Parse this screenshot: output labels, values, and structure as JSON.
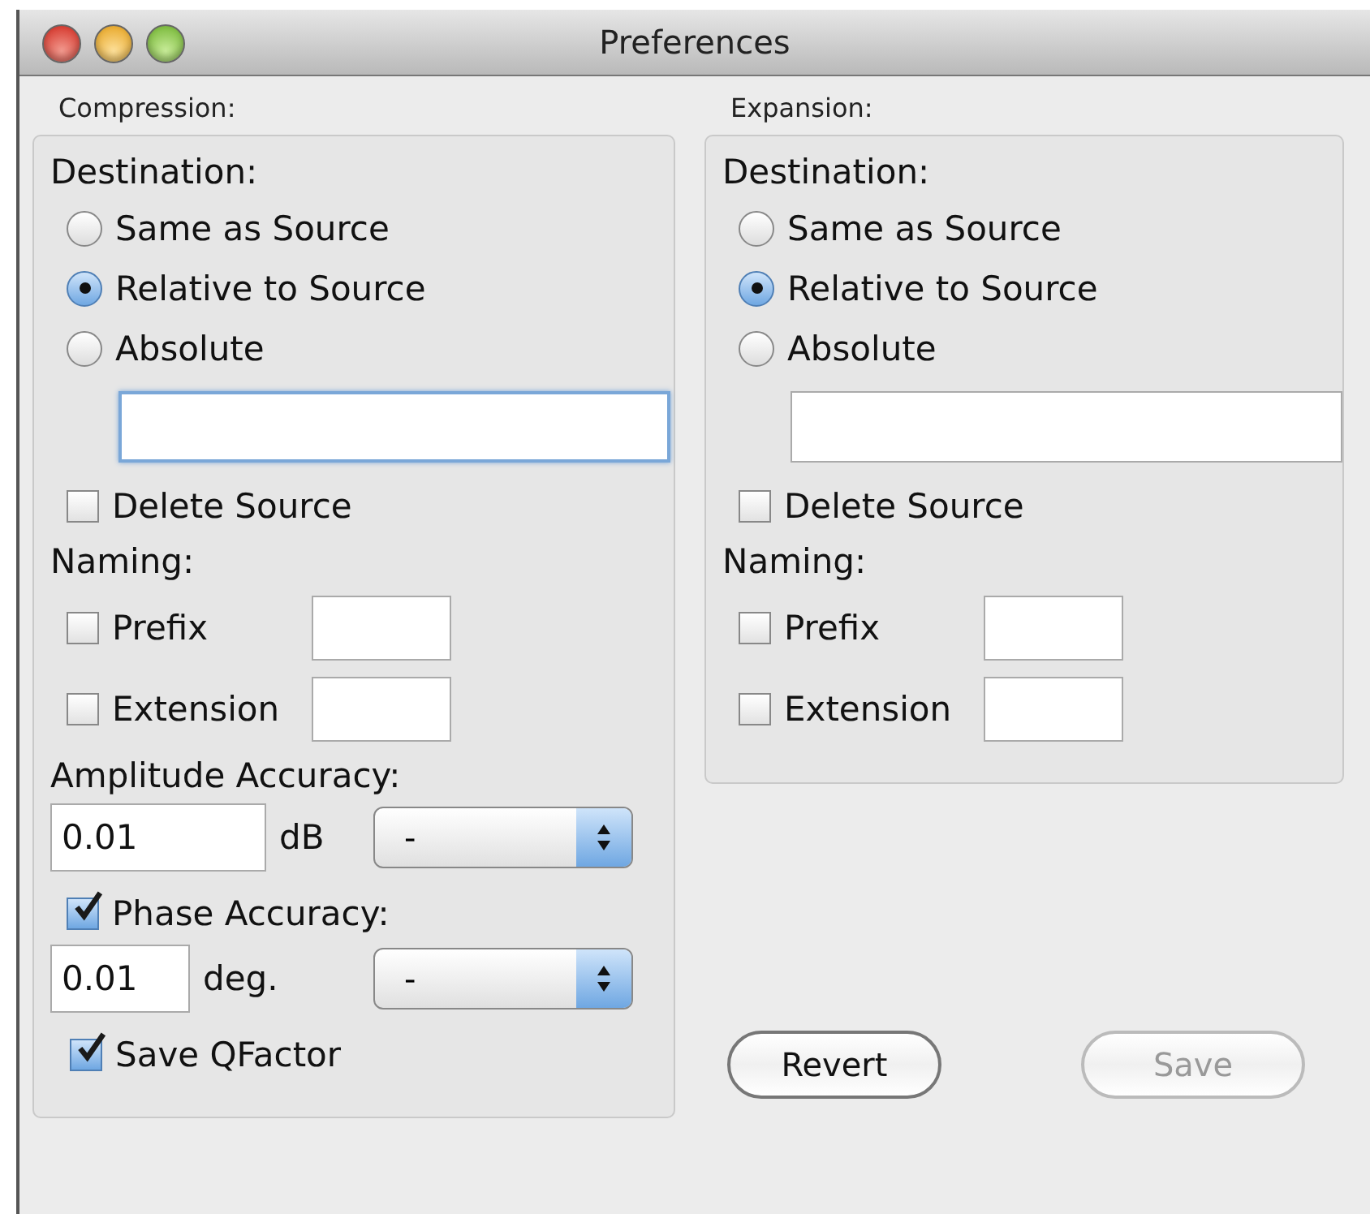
{
  "window": {
    "title": "Preferences"
  },
  "compression": {
    "heading": "Compression:",
    "destination_label": "Destination:",
    "destination_options": [
      {
        "label": "Same as Source",
        "selected": false
      },
      {
        "label": "Relative to Source",
        "selected": true
      },
      {
        "label": "Absolute",
        "selected": false
      }
    ],
    "path_field": {
      "focused": true
    },
    "delete_source": {
      "label": "Delete Source",
      "checked": false
    },
    "naming_label": "Naming:",
    "naming": [
      {
        "label": "Prefix",
        "checked": false
      },
      {
        "label": "Extension",
        "checked": false
      }
    ],
    "amplitude": {
      "label": "Amplitude Accuracy:",
      "value": "0.01",
      "unit": "dB",
      "choice": "-"
    },
    "phase": {
      "label": "Phase Accuracy:",
      "checked": true,
      "value": "0.01",
      "unit": "deg.",
      "choice": "-"
    },
    "save_qfactor": {
      "label": "Save QFactor",
      "checked": true
    }
  },
  "expansion": {
    "heading": "Expansion:",
    "destination_label": "Destination:",
    "destination_options": [
      {
        "label": "Same as Source",
        "selected": false
      },
      {
        "label": "Relative to Source",
        "selected": true
      },
      {
        "label": "Absolute",
        "selected": false
      }
    ],
    "path_field": {
      "focused": false
    },
    "delete_source": {
      "label": "Delete Source",
      "checked": false
    },
    "naming_label": "Naming:",
    "naming": [
      {
        "label": "Prefix",
        "checked": false
      },
      {
        "label": "Extension",
        "checked": false
      }
    ]
  },
  "buttons": [
    {
      "label": "Revert",
      "disabled": false
    },
    {
      "label": "Save",
      "disabled": true
    }
  ]
}
